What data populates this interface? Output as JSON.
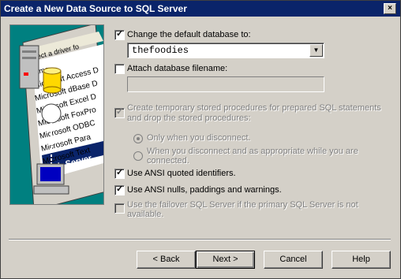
{
  "window": {
    "title": "Create a New Data Source to SQL Server",
    "close_label": "×"
  },
  "illustration": {
    "header": "Select a driver fo",
    "column": "Name",
    "drivers": [
      "Microsoft Access D",
      "Microsoft dBase D",
      "Microsoft Excel D",
      "Microsoft FoxPro",
      "Microsoft ODBC",
      "Microsoft Para",
      "Microsoft Text",
      "SQL Server"
    ]
  },
  "options": {
    "change_db": {
      "label": "Change the default database to:",
      "checked": true
    },
    "database_value": "thefoodies",
    "attach_db": {
      "label": "Attach database filename:",
      "checked": false
    },
    "temp_procs": {
      "label_line1": "Create temporary stored procedures for prepared SQL statements",
      "label_line2": "and drop the stored procedures:"
    },
    "radio_only_disconnect": "Only when you disconnect.",
    "radio_when_appropriate_line1": "When you disconnect and as appropriate while you are",
    "radio_when_appropriate_line2": "connected.",
    "ansi_quoted": {
      "label": "Use ANSI quoted identifiers.",
      "checked": true
    },
    "ansi_nulls": {
      "label": "Use ANSI nulls, paddings and warnings.",
      "checked": true
    },
    "failover": {
      "label_line1": "Use the failover SQL Server if the primary SQL Server is not",
      "label_line2": "available."
    }
  },
  "buttons": {
    "back": "< Back",
    "next": "Next >",
    "cancel": "Cancel",
    "help": "Help"
  }
}
